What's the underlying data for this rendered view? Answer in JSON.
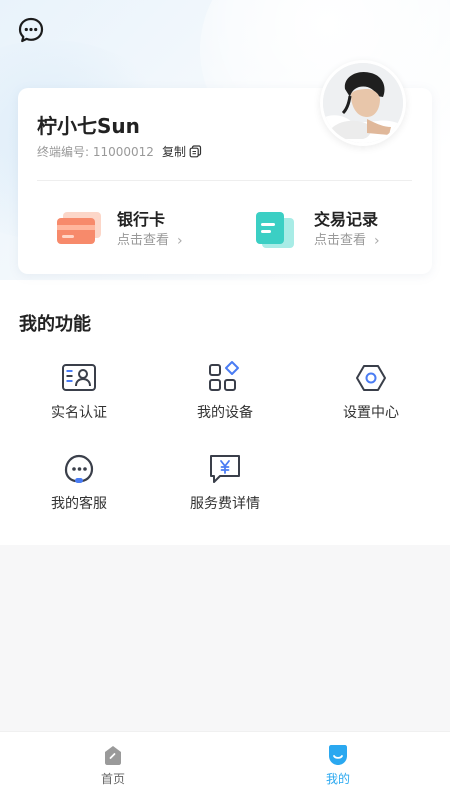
{
  "profile": {
    "name": "柠小七Sun",
    "terminal_label": "终端编号: 11000012",
    "copy_label": "复制"
  },
  "entries": [
    {
      "title": "银行卡",
      "sub": "点击查看"
    },
    {
      "title": "交易记录",
      "sub": "点击查看"
    }
  ],
  "functions": {
    "title": "我的功能",
    "items": [
      {
        "label": "实名认证",
        "icon": "id-card-icon"
      },
      {
        "label": "我的设备",
        "icon": "devices-icon"
      },
      {
        "label": "设置中心",
        "icon": "settings-icon"
      },
      {
        "label": "我的客服",
        "icon": "customer-service-icon"
      },
      {
        "label": "服务费详情",
        "icon": "service-fee-icon"
      }
    ]
  },
  "tabbar": {
    "tabs": [
      {
        "label": "首页",
        "active": false
      },
      {
        "label": "我的",
        "active": true
      }
    ],
    "active_color": "#2aa8f0",
    "inactive_color": "#666666"
  },
  "colors": {
    "bank_card": "#f78a6b",
    "records": "#3bcfc4",
    "icon_stroke": "#3a3f4a",
    "icon_accent": "#4a7cf3"
  }
}
